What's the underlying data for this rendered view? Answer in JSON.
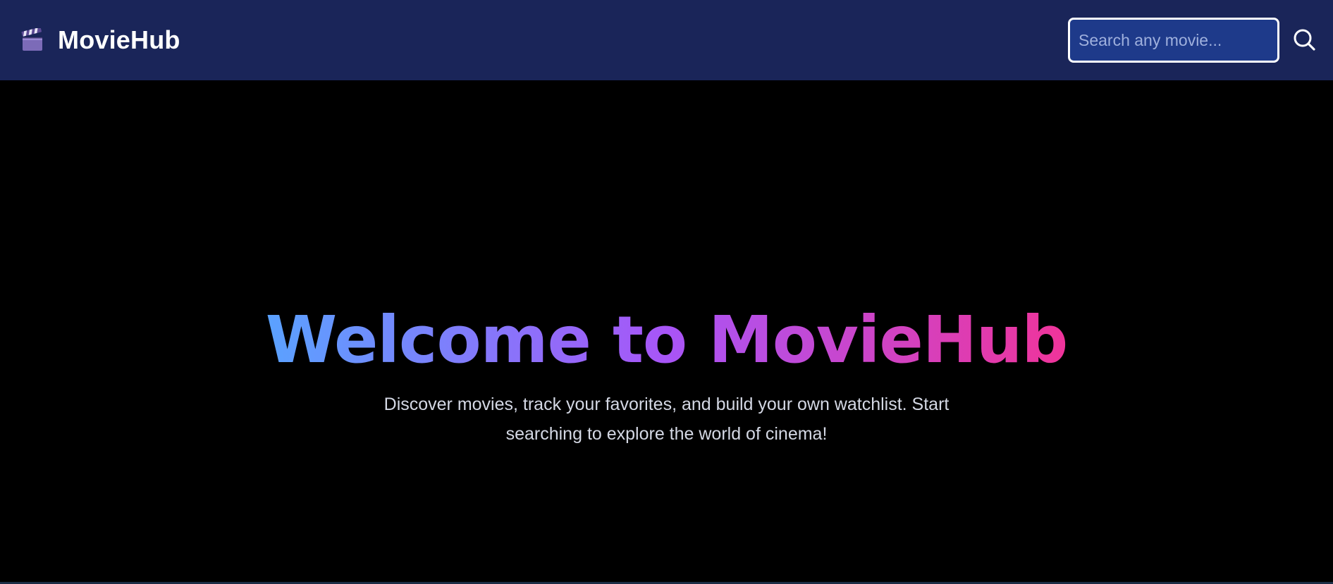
{
  "navbar": {
    "brand_icon": "clapperboard-icon",
    "brand_title": "MovieHub",
    "search": {
      "placeholder": "Search any movie...",
      "value": "",
      "button_icon": "search-icon"
    }
  },
  "hero": {
    "title": "Welcome to MovieHub",
    "subtitle": "Discover movies, track your favorites, and build your own watchlist. Start searching to explore the world of cinema!"
  },
  "colors": {
    "navbar_bg": "#1a2559",
    "search_bg": "#1e3a8a",
    "page_bg": "#000000",
    "title_gradient": [
      "#5aa2ff",
      "#a855f7",
      "#f0349a"
    ]
  }
}
